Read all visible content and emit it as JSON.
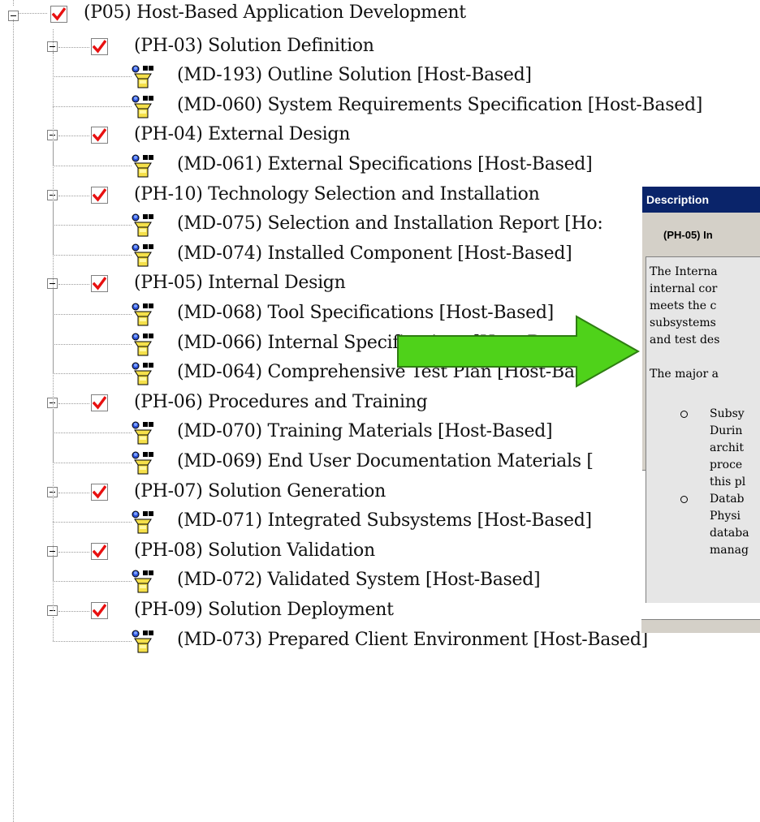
{
  "tree": {
    "root": {
      "label": "(P05) Host-Based Application Development"
    },
    "phases": [
      {
        "label": "(PH-03) Solution Definition",
        "items": [
          "(MD-193) Outline Solution [Host-Based]",
          "(MD-060) System Requirements Specification [Host-Based]"
        ]
      },
      {
        "label": "(PH-04) External Design",
        "items": [
          "(MD-061) External Specifications [Host-Based]"
        ]
      },
      {
        "label": "(PH-10) Technology Selection and Installation",
        "items": [
          "(MD-075) Selection and Installation Report [Ho:",
          "(MD-074) Installed Component [Host-Based]"
        ]
      },
      {
        "label": "(PH-05) Internal Design",
        "items": [
          "(MD-068) Tool Specifications [Host-Based]",
          "(MD-066) Internal Specifications [Host-Based]",
          "(MD-064) Comprehensive Test Plan [Host-Base"
        ]
      },
      {
        "label": "(PH-06) Procedures and Training",
        "items": [
          "(MD-070) Training Materials [Host-Based]",
          "(MD-069) End User Documentation Materials ["
        ]
      },
      {
        "label": "(PH-07) Solution Generation",
        "items": [
          "(MD-071) Integrated Subsystems [Host-Based]"
        ]
      },
      {
        "label": "(PH-08) Solution Validation",
        "items": [
          "(MD-072) Validated System [Host-Based]"
        ]
      },
      {
        "label": "(PH-09) Solution Deployment",
        "items": [
          "(MD-073) Prepared Client Environment [Host-Based]"
        ]
      }
    ]
  },
  "description_panel": {
    "title": "Description",
    "heading": "(PH-05) In",
    "lines": [
      "The Interna",
      "internal cor",
      "meets the c",
      "subsystems",
      "and test des",
      "",
      "The major a"
    ],
    "bullets": [
      [
        "Subsy",
        "Durin",
        "archit",
        "proce",
        "this pl"
      ],
      [
        "Datab",
        "Physi",
        "databa",
        "manag"
      ]
    ]
  },
  "colors": {
    "check_red": "#e81010",
    "arrow_green": "#4fd21a",
    "panel_title_bg": "#0a246a",
    "panel_bg": "#d4d0c8"
  }
}
